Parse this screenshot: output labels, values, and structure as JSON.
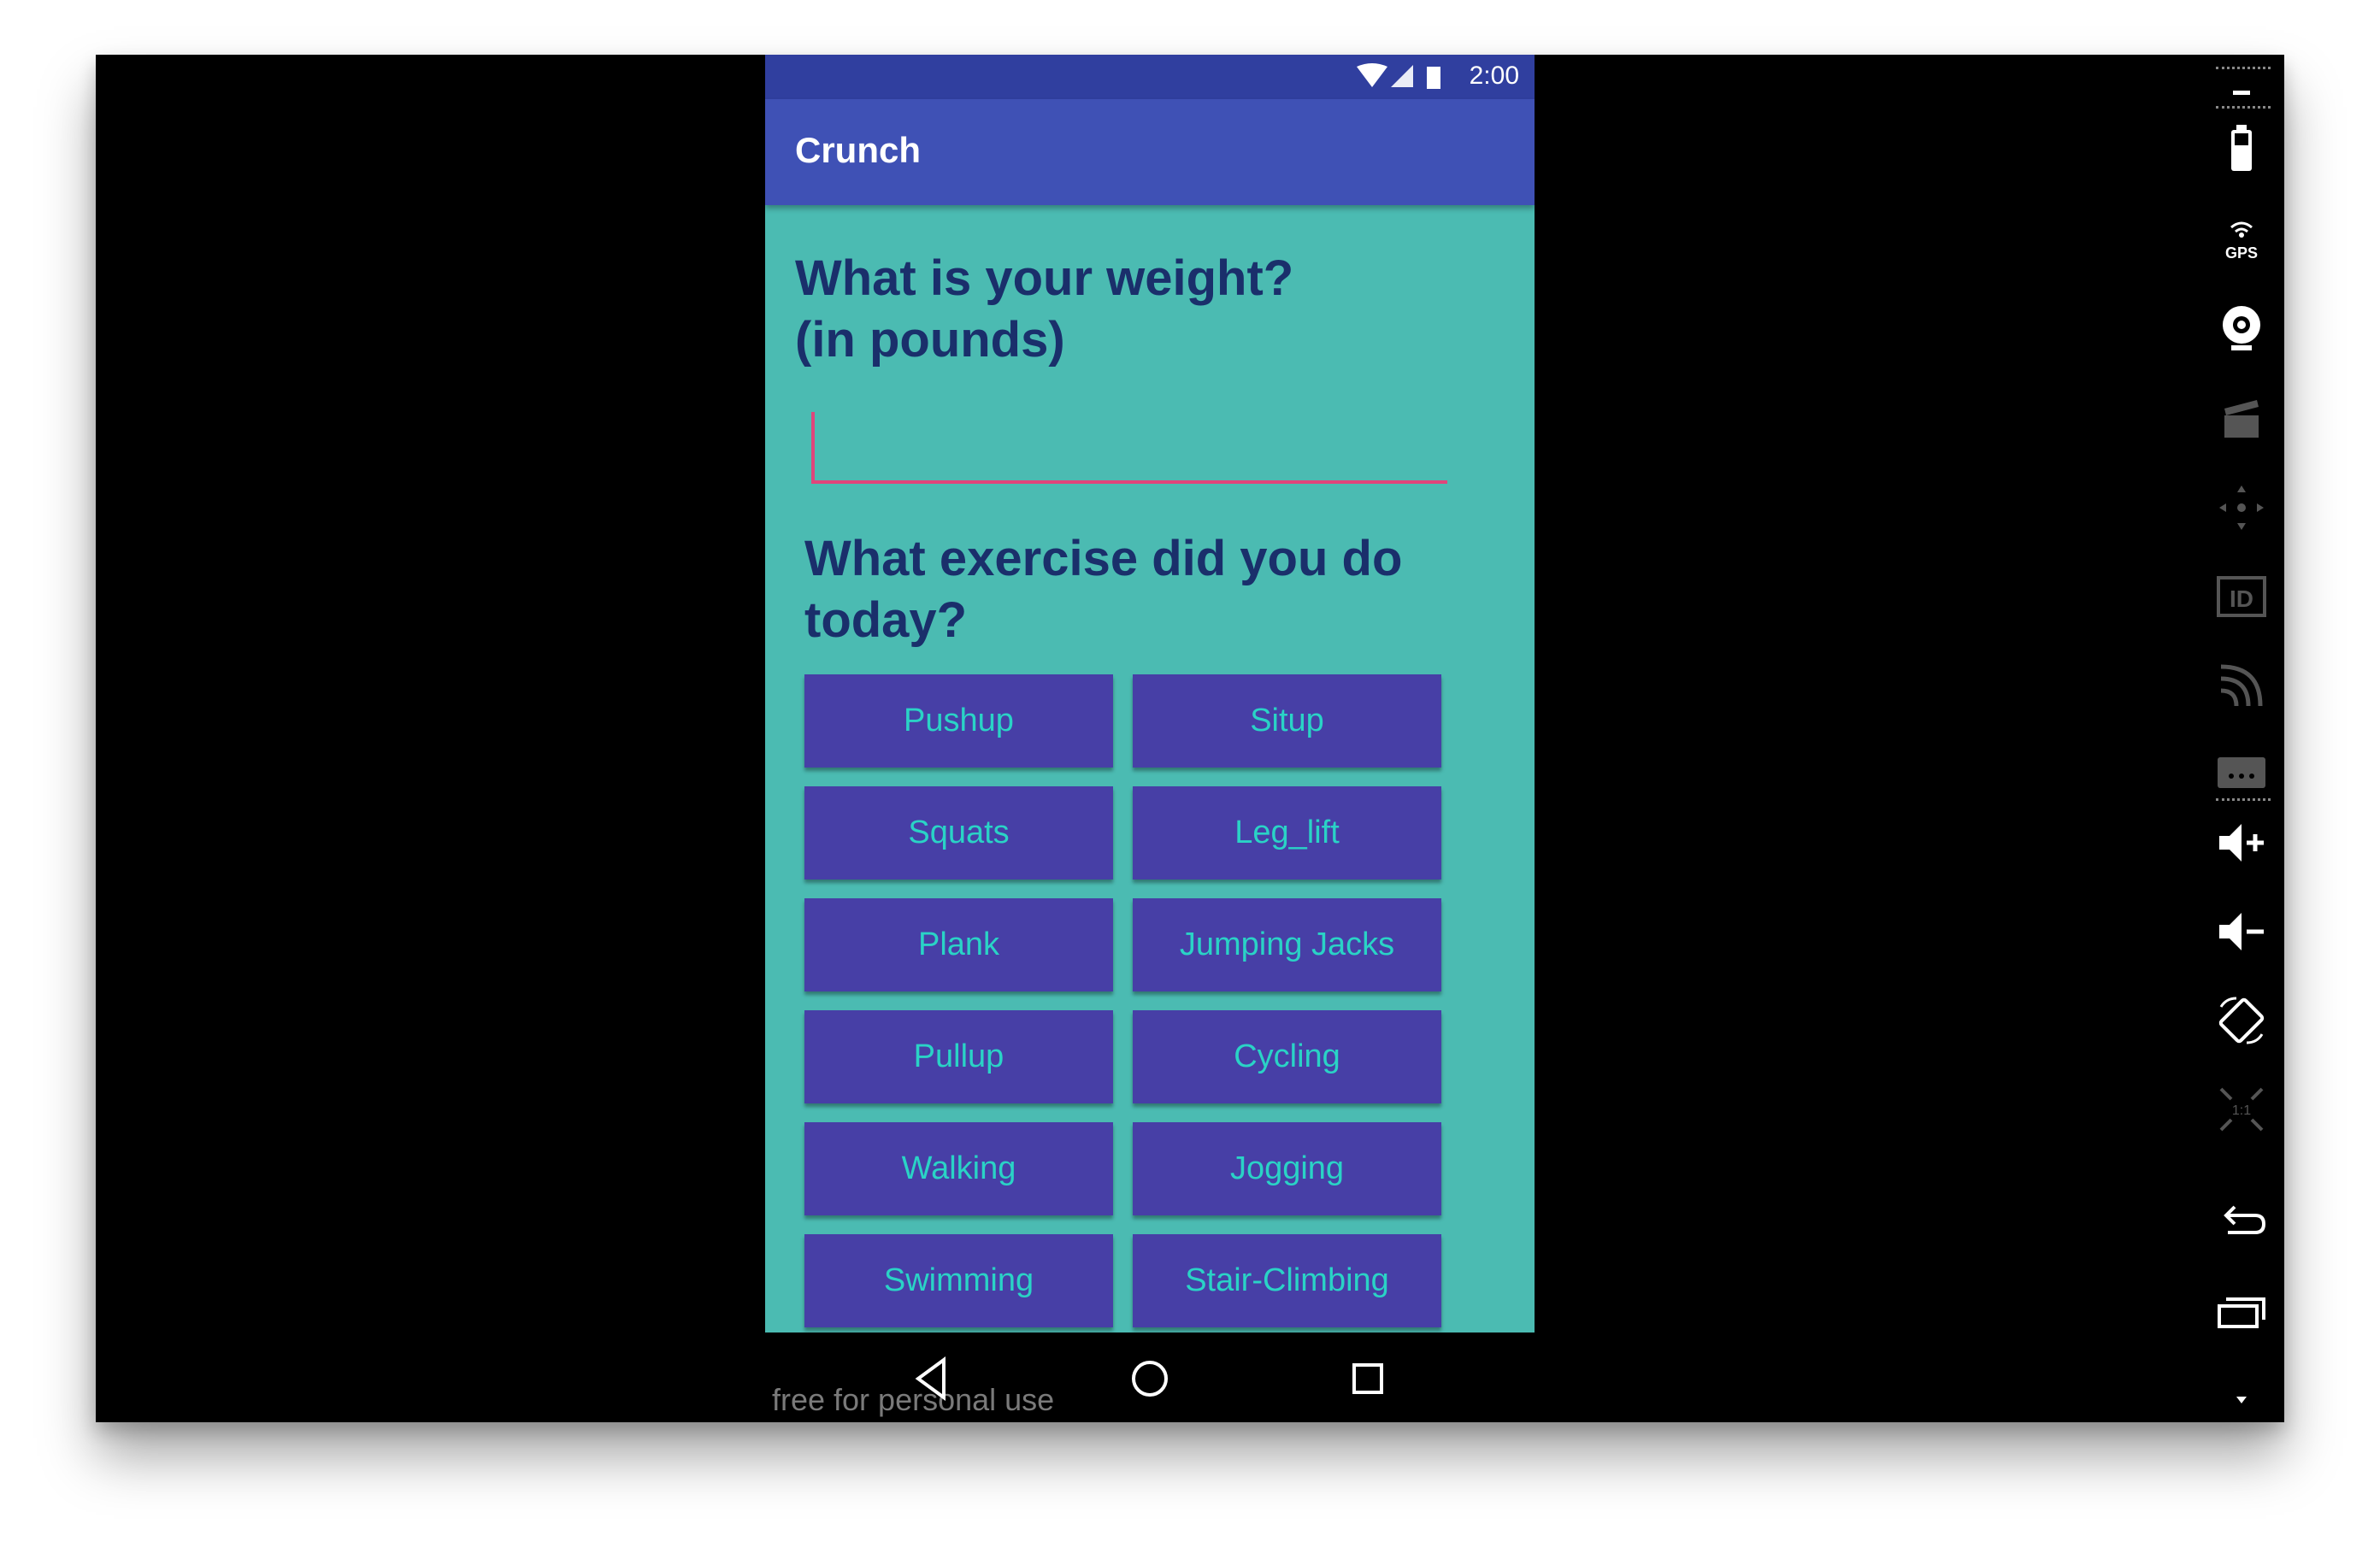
{
  "status_bar": {
    "time": "2:00"
  },
  "app_bar": {
    "title": "Crunch"
  },
  "form": {
    "weight_question": "What is your weight?\n(in pounds)",
    "weight_value": "",
    "exercise_question": "What exercise did you do\ntoday?"
  },
  "exercises": [
    "Pushup",
    "Situp",
    "Squats",
    "Leg_lift",
    "Plank",
    "Jumping Jacks",
    "Pullup",
    "Cycling",
    "Walking",
    "Jogging",
    "Swimming",
    "Stair-Climbing"
  ],
  "watermark": "free for personal use",
  "colors": {
    "status_bar": "#303f9f",
    "app_bar": "#3f51b5",
    "background": "#4bbbb2",
    "button": "#473fa6",
    "button_text": "#2ad3c6",
    "question_text": "#1a2f6b",
    "input_underline": "#e0457b"
  },
  "nav_icons": [
    "back-icon",
    "home-icon",
    "recents-icon"
  ],
  "sidebar_icons": [
    "power-icon",
    "battery-icon",
    "gps-icon",
    "camera-icon",
    "screen-record-icon",
    "dpad-icon",
    "id-icon",
    "cast-icon",
    "more-icon",
    "volume-up-icon",
    "volume-down-icon",
    "rotate-icon",
    "scale-icon",
    "back-icon",
    "recents-icon",
    "chevron-down-icon"
  ]
}
